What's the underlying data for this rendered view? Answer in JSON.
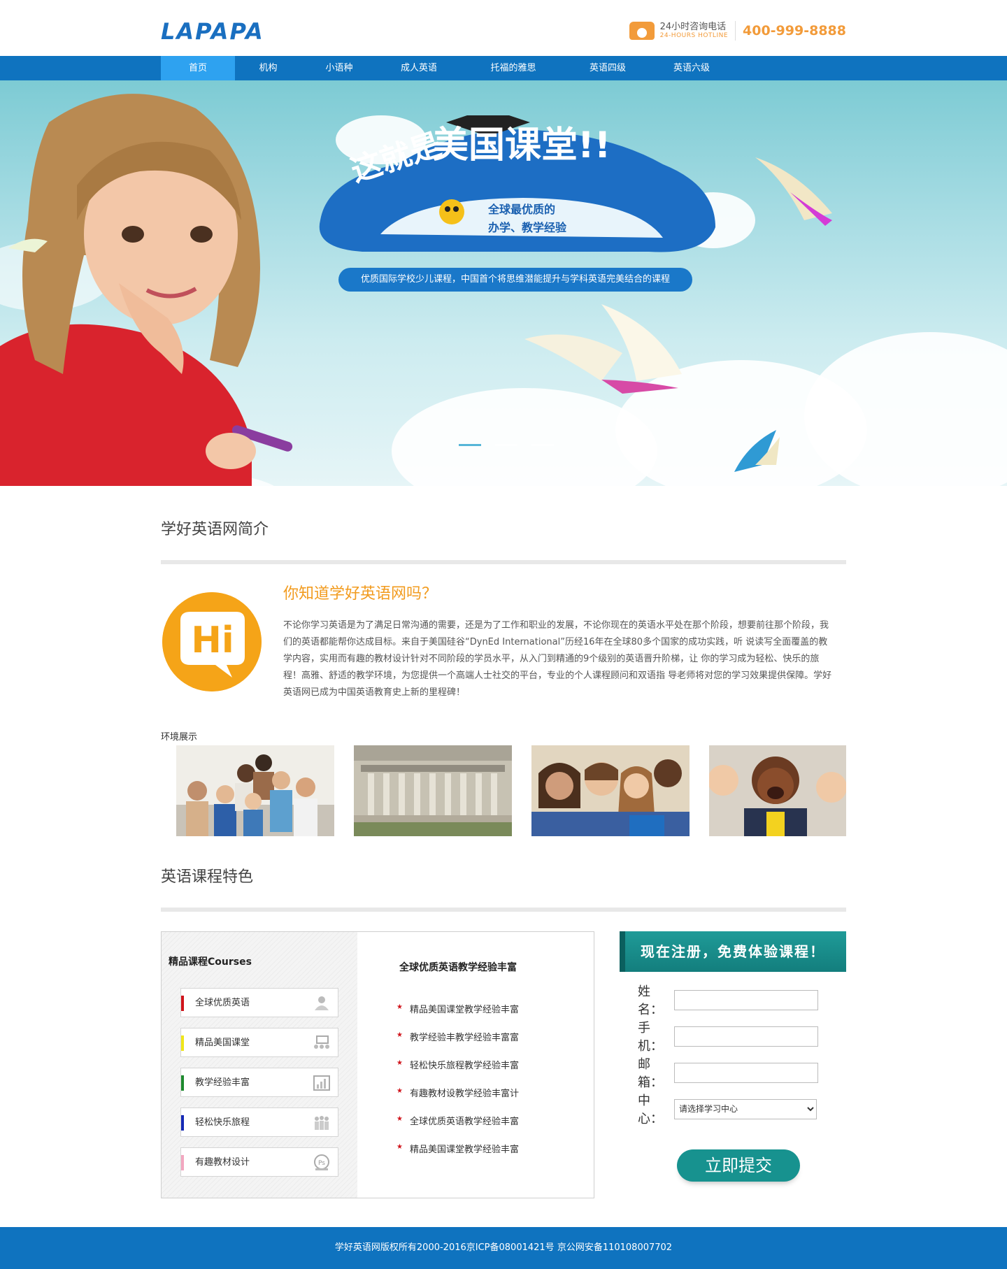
{
  "header": {
    "logo_text": "LAPAPA",
    "hotline_cn": "24小时咨询电话",
    "hotline_en": "24-HOURS HOTLINE",
    "hotline_number": "400-999-8888"
  },
  "nav": {
    "items": [
      {
        "label": "首页",
        "active": true
      },
      {
        "label": "机构",
        "active": false
      },
      {
        "label": "小语种",
        "active": false
      },
      {
        "label": "成人英语",
        "active": false
      },
      {
        "label": "托福的雅思",
        "active": false
      },
      {
        "label": "英语四级",
        "active": false
      },
      {
        "label": "英语六级",
        "active": false
      }
    ]
  },
  "banner": {
    "headline": "这就是美国课堂!!",
    "tagline_line1": "全球最优质的",
    "tagline_line2": "办学、教学经验",
    "subtitle": "优质国际学校少儿课程，中国首个将思维潜能提升与学科英语完美结合的课程",
    "slides": 3,
    "active_slide": 1
  },
  "intro": {
    "section_title": "学好英语网简介",
    "logo_text": "Hi",
    "question": "你知道学好英语网吗？",
    "paragraph": "不论你学习英语是为了满足日常沟通的需要，还是为了工作和职业的发展，不论你现在的英语水平处在那个阶段，想要前往那个阶段，我们的英语都能帮你达成目标。来自于美国硅谷“DynEd International”历经16年在全球80多个国家的成功实践，听 说读写全面覆盖的教学内容，实用而有趣的教材设计针对不同阶段的学员水平，从入门到精通的9个级别的英语晋升阶梯，让 你的学习成为轻松、快乐的旅程！高雅、舒适的教学环境，为您提供一个高端人士社交的平台，专业的个人课程顾问和双语指 导老师将对您的学习效果提供保障。学好英语网已成为中国英语教育史上新的里程碑！",
    "env_label": "环境展示"
  },
  "features": {
    "section_title": "英语课程特色",
    "courses_title": "精品课程Courses",
    "courses": [
      {
        "label": "全球优质英语",
        "color": "#d0141b",
        "icon": "people-icon"
      },
      {
        "label": "精品美国课堂",
        "color": "#f0e61a",
        "icon": "classroom-icon"
      },
      {
        "label": "教学经验丰富",
        "color": "#1e8a2e",
        "icon": "chart-icon"
      },
      {
        "label": "轻松快乐旅程",
        "color": "#1529b5",
        "icon": "team-icon"
      },
      {
        "label": "有趣教材设计",
        "color": "#f3a7c0",
        "icon": "ps-icon"
      }
    ],
    "right_title": "全球优质英语教学经验丰富",
    "list": [
      "精品美国课堂教学经验丰富",
      "教学经验丰教学经验丰富富",
      "轻松快乐旅程教学经验丰富",
      "有趣教材设教学经验丰富计",
      "全球优质英语教学经验丰富",
      "精品美国课堂教学经验丰富"
    ]
  },
  "register": {
    "title": "现在注册，免费体验课程！",
    "name_label": "姓名：",
    "phone_label": "手机：",
    "email_label": "邮箱：",
    "center_label": "中心：",
    "center_selected": "请选择学习中心",
    "submit_label": "立即提交"
  },
  "footer": {
    "text": "学好英语网版权所有2000-2016京ICP备08001421号  京公网安备110108007702"
  },
  "colors": {
    "primary_blue": "#0f73bf",
    "nav_active": "#2ea2f0",
    "orange": "#f29b1e",
    "teal": "#17928f"
  }
}
